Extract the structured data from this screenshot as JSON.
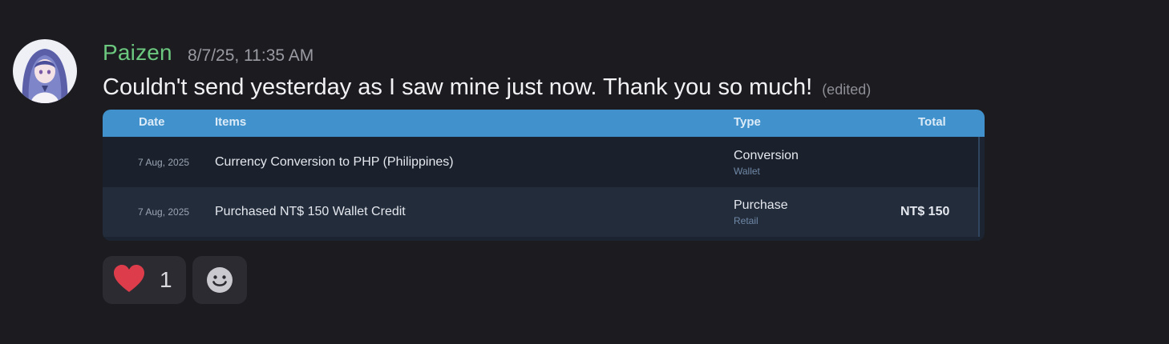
{
  "message": {
    "author": "Paizen",
    "timestamp": "8/7/25, 11:35 AM",
    "text": "Couldn't send yesterday as I saw mine just now. Thank you so much!",
    "edited_label": "(edited)"
  },
  "embed": {
    "columns": {
      "date": "Date",
      "items": "Items",
      "type": "Type",
      "total": "Total"
    },
    "rows": [
      {
        "date": "7 Aug, 2025",
        "item": "Currency Conversion to PHP (Philippines)",
        "type": "Conversion",
        "subtype": "Wallet",
        "total": ""
      },
      {
        "date": "7 Aug, 2025",
        "item": "Purchased NT$ 150 Wallet Credit",
        "type": "Purchase",
        "subtype": "Retail",
        "total": "NT$ 150"
      }
    ]
  },
  "reactions": [
    {
      "emoji": "heart-icon",
      "count": "1"
    }
  ],
  "add_reaction": {
    "icon": "smiley-icon"
  },
  "colors": {
    "background": "#1b1b20",
    "username": "#6cc87f",
    "embed_header": "#4192cc",
    "heart": "#dd3d4a"
  }
}
